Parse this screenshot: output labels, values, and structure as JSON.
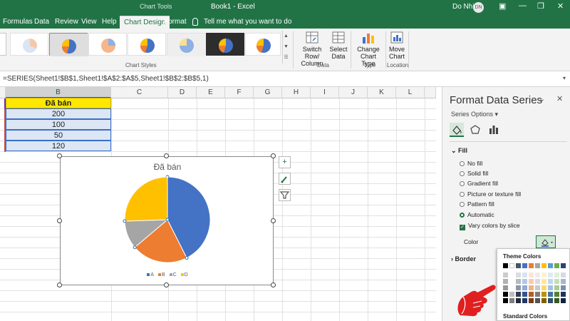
{
  "titlebar": {
    "tools_label": "Chart Tools",
    "document": "Book1  -  Excel",
    "user": "Do Nhi",
    "avatar_initials": "DN",
    "min": "—",
    "restore": "❐",
    "close": "✕"
  },
  "tabs": [
    {
      "label": "Formulas"
    },
    {
      "label": "Data"
    },
    {
      "label": "Review"
    },
    {
      "label": "View"
    },
    {
      "label": "Help"
    },
    {
      "label": "Chart Design",
      "active": true
    },
    {
      "label": "Format"
    }
  ],
  "tellme": "Tell me what you want to do",
  "ribbon": {
    "chart_styles_label": "Chart Styles",
    "switch_row_col": "Switch Row/ Column",
    "select_data": "Select Data",
    "data_group": "Data",
    "change_chart_type": "Change Chart Type",
    "type_group": "Type",
    "move_chart": "Move Chart",
    "location_group": "Location"
  },
  "formula_bar": {
    "formula": "=SERIES(Sheet1!$B$1,Sheet1!$A$2:$A$5,Sheet1!$B$2:$B$5,1)"
  },
  "columns": [
    "B",
    "C",
    "D",
    "E",
    "F",
    "G",
    "H",
    "I",
    "J",
    "K",
    "L"
  ],
  "table": {
    "header": "Đã bán",
    "values": [
      "200",
      "100",
      "50",
      "120"
    ]
  },
  "chart_data": {
    "type": "pie",
    "title": "Đã bán",
    "categories": [
      "A",
      "B",
      "C",
      "D"
    ],
    "values": [
      200,
      100,
      50,
      120
    ],
    "colors": [
      "#4472c4",
      "#ed7d31",
      "#a5a5a5",
      "#ffc000"
    ],
    "legend": "bottom"
  },
  "pane": {
    "title": "Format Data Series",
    "series_options": "Series Options",
    "fill_section": "Fill",
    "fill_options": [
      {
        "label": "No fill",
        "selected": false
      },
      {
        "label": "Solid fill",
        "selected": false
      },
      {
        "label": "Gradient fill",
        "selected": false
      },
      {
        "label": "Picture or texture fill",
        "selected": false
      },
      {
        "label": "Pattern fill",
        "selected": false
      },
      {
        "label": "Automatic",
        "selected": true
      }
    ],
    "vary_colors": "Vary colors by slice",
    "color_label": "Color",
    "border_section": "Border"
  },
  "palette": {
    "theme_colors_label": "Theme Colors",
    "standard_colors_label": "Standard Colors",
    "theme_top_row": [
      "#000000",
      "#ffffff",
      "#44546a",
      "#4472c4",
      "#ed7d31",
      "#a5a5a5",
      "#ffc000",
      "#5b9bd5",
      "#70ad47",
      "#264478"
    ]
  }
}
